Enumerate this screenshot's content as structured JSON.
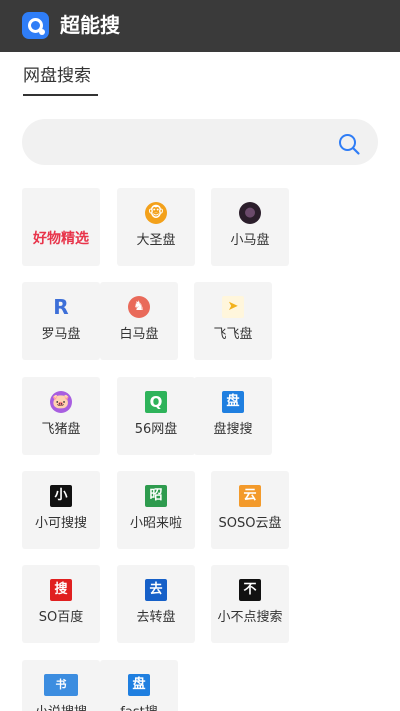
{
  "header": {
    "app_title": "超能搜",
    "bar_color": "#3a3a3a",
    "logo_color": "#2f7df6"
  },
  "section": {
    "title": "网盘搜索"
  },
  "search": {
    "value": "",
    "icon": "search-icon",
    "accent": "#2f7df6"
  },
  "tiles": [
    {
      "label": "好物精选",
      "featured": true,
      "color": "#e8344a"
    },
    {
      "label": "大圣盘",
      "icon": "monkey-icon",
      "glyph": "🐵",
      "color": "#f3a11b"
    },
    {
      "label": "小马盘",
      "icon": "dark-creature-icon",
      "glyph": "●",
      "color": "#2b1e2b"
    },
    {
      "label": "罗马盘",
      "icon": "letter-r-icon",
      "glyph": "R",
      "color": "#3d6fd8"
    },
    {
      "label": "白马盘",
      "icon": "horse-icon",
      "glyph": "♞",
      "color": "#e96a5a"
    },
    {
      "label": "飞飞盘",
      "icon": "paper-plane-icon",
      "glyph": "➤",
      "color": "#f2b21c"
    },
    {
      "label": "飞猪盘",
      "icon": "pig-icon",
      "glyph": "🐷",
      "color": "#a85ee0"
    },
    {
      "label": "56网盘",
      "icon": "magnifier-q-icon",
      "glyph": "Q",
      "color": "#2eb35a"
    },
    {
      "label": "盘搜搜",
      "icon": "pan-badge-icon",
      "glyph": "盘",
      "color": "#1f7fe0"
    },
    {
      "label": "小可搜搜",
      "icon": "xiao-badge-icon",
      "glyph": "小",
      "color": "#111111"
    },
    {
      "label": "小昭来啦",
      "icon": "zhao-badge-icon",
      "glyph": "昭",
      "color": "#2e9b4e"
    },
    {
      "label": "SOSO云盘",
      "icon": "yun-badge-icon",
      "glyph": "云",
      "color": "#f39a2b"
    },
    {
      "label": "SO百度",
      "icon": "sou-badge-icon",
      "glyph": "搜",
      "color": "#e02020"
    },
    {
      "label": "去转盘",
      "icon": "qu-badge-icon",
      "glyph": "去",
      "color": "#1660c8"
    },
    {
      "label": "小不点搜索",
      "icon": "bu-badge-icon",
      "glyph": "不",
      "color": "#111111"
    },
    {
      "label": "小说搜搜",
      "icon": "book-icon",
      "glyph": "书",
      "color": "#3c8de0"
    },
    {
      "label": "fast搜",
      "icon": "pan-badge-icon",
      "glyph": "盘",
      "color": "#1f7fe0"
    }
  ]
}
